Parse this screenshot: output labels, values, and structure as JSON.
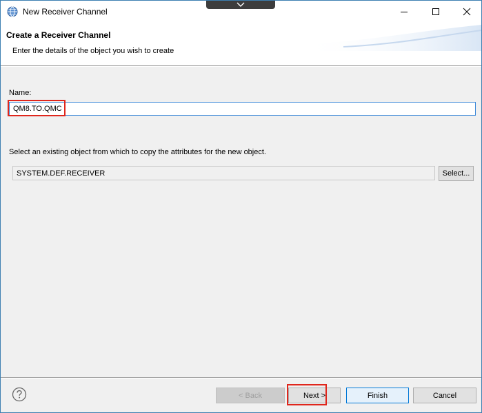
{
  "window": {
    "title": "New Receiver Channel",
    "icons": {
      "app": "globe-icon",
      "pulldown": "chevron-down-icon",
      "minimize": "minimize-icon",
      "maximize": "maximize-icon",
      "close": "close-icon"
    }
  },
  "banner": {
    "title": "Create a Receiver Channel",
    "description": "Enter the details of the object you wish to create"
  },
  "form": {
    "name_label": "Name:",
    "name_value": "QM8.TO.QMC",
    "copy_label": "Select an existing object from which to copy the attributes for the new object.",
    "copy_value": "SYSTEM.DEF.RECEIVER",
    "select_button": "Select..."
  },
  "footer": {
    "help_icon": "help-icon",
    "back_button": "< Back",
    "next_button": "Next >",
    "finish_button": "Finish",
    "cancel_button": "Cancel"
  },
  "colors": {
    "highlight": "#e0261c",
    "focus_border": "#3c88d8",
    "default_button_border": "#0078d7"
  }
}
